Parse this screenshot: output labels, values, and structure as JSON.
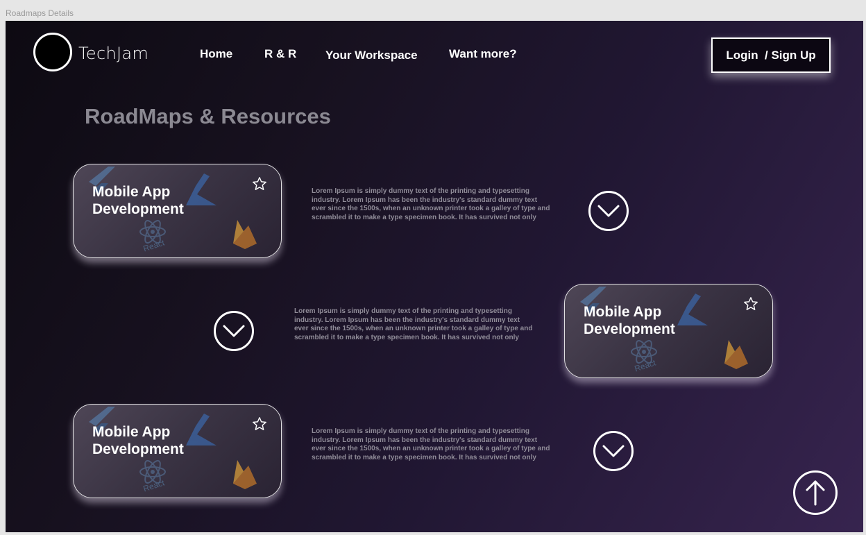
{
  "frame_label": "Roadmaps Details",
  "header": {
    "brand": "TechJam",
    "nav": [
      "Home",
      "R & R",
      "Your Workspace",
      "Want more?"
    ],
    "login_label": "Login  / Sign Up"
  },
  "page_title": "RoadMaps & Resources",
  "roadmaps": [
    {
      "title_line1": "Mobile App",
      "title_line2": "Development",
      "description": "Lorem Ipsum is simply dummy text of the printing and typesetting industry. Lorem Ipsum has been the industry's standard dummy text ever since the 1500s, when an unknown printer took a galley of type and scrambled it to make a type specimen book. It has survived not only",
      "deco_react_label": "React"
    },
    {
      "title_line1": "Mobile App",
      "title_line2": "Development",
      "description": "Lorem Ipsum is simply dummy text of the printing and typesetting industry. Lorem Ipsum has been the industry's standard dummy text ever since the 1500s, when an unknown printer took a galley of type and scrambled it to make a type specimen book. It has survived not only",
      "deco_react_label": "React"
    },
    {
      "title_line1": "Mobile App",
      "title_line2": "Development",
      "description": "Lorem Ipsum is simply dummy text of the printing and typesetting industry. Lorem Ipsum has been the industry's standard dummy text ever since the 1500s, when an unknown printer took a galley of type and scrambled it to make a type specimen book. It has survived not only",
      "deco_react_label": "React"
    }
  ],
  "icons": {
    "logo": "logo-circle",
    "favorite": "star-outline-icon",
    "expand": "chevron-down-icon",
    "scroll_top": "arrow-up-icon"
  },
  "colors": {
    "background_start": "#0d0a12",
    "background_end": "#37244f",
    "title_gray": "#8b8992",
    "text_white": "#ffffff"
  }
}
